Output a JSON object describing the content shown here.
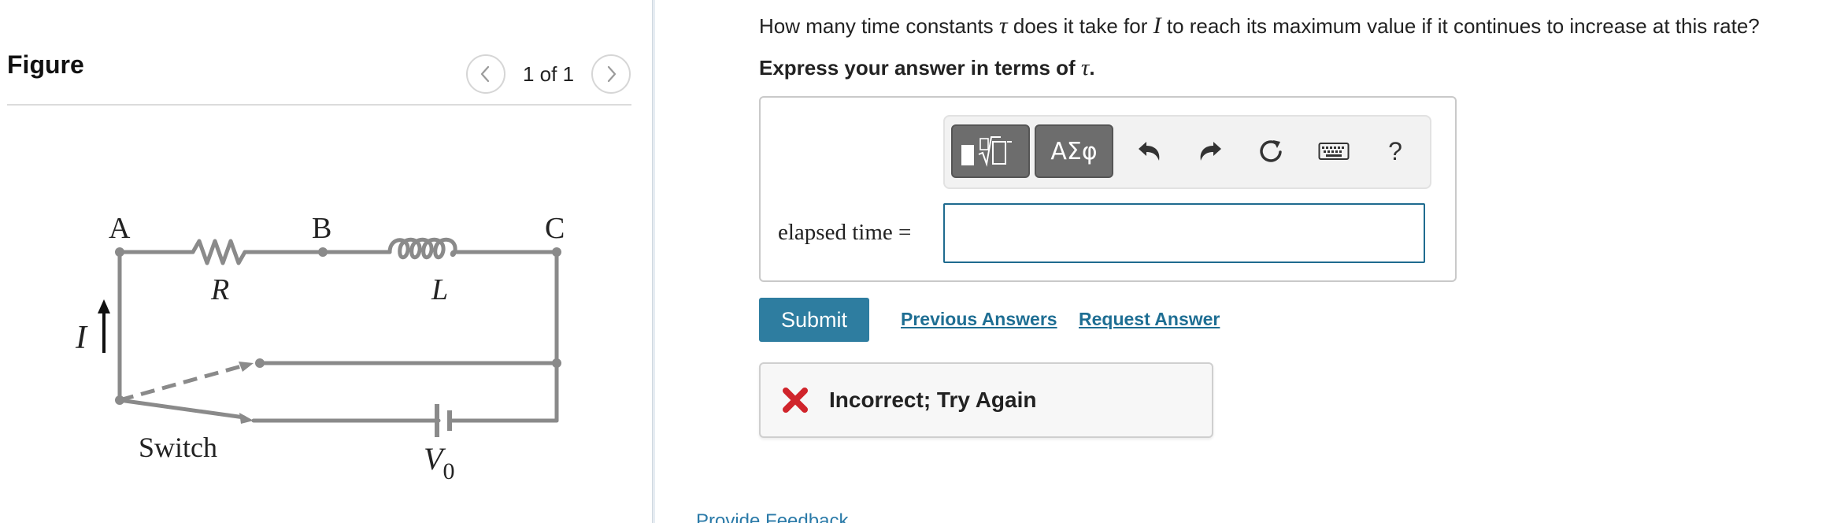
{
  "figure": {
    "title": "Figure",
    "pager": {
      "count": "1 of 1"
    },
    "circuit": {
      "labels": {
        "node_a": "A",
        "node_b": "B",
        "node_c": "C",
        "resistor": "R",
        "inductor": "L",
        "current": "I",
        "switch": "Switch",
        "battery": "V",
        "battery_subscript": "0"
      }
    }
  },
  "question": {
    "prefix": "How many time constants ",
    "tau": "τ",
    "middle": " does it take for ",
    "current": "I",
    "suffix": " to reach its maximum value if it continues to increase at this rate?"
  },
  "instruction": {
    "prefix": "Express your answer in terms of ",
    "tau": "τ",
    "suffix": "."
  },
  "toolbar": {
    "greek_label": "ΑΣφ",
    "help_label": "?"
  },
  "answer": {
    "label": "elapsed time =",
    "value": ""
  },
  "actions": {
    "submit_label": "Submit",
    "previous_answers_label": "Previous Answers",
    "request_answer_label": "Request Answer"
  },
  "feedback": {
    "status_text": "Incorrect; Try Again"
  },
  "footer": {
    "provide_feedback_label": "Provide Feedback"
  },
  "colors": {
    "primary": "#2e7da0",
    "link": "#1e6e93",
    "error": "#d0242b",
    "toolbar_dark": "#6d6d6d",
    "circuit_wire": "#8a8a8a"
  }
}
